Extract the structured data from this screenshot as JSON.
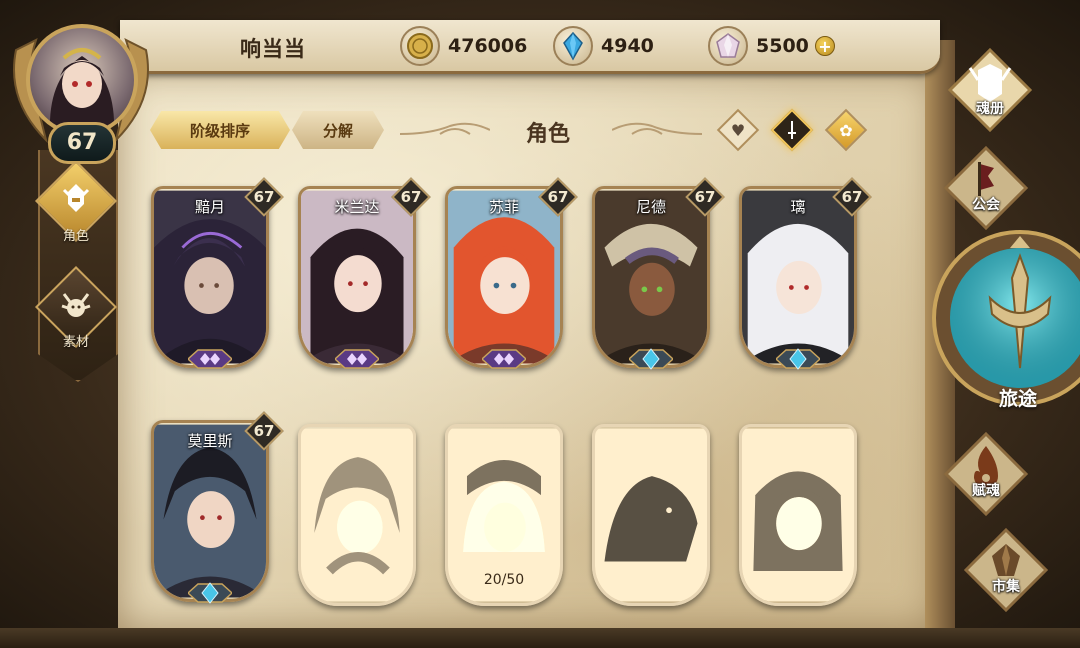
{
  "player": {
    "name": "响当当",
    "level": "67"
  },
  "currencies": [
    {
      "name": "gold",
      "icon": "gold-coin-icon",
      "value": "476006"
    },
    {
      "name": "gem",
      "icon": "blue-crystal-icon",
      "value": "4940"
    },
    {
      "name": "diamond",
      "icon": "pink-diamond-icon",
      "value": "5500",
      "has_plus": true
    }
  ],
  "left_nav": [
    {
      "label": "角色",
      "icon": "character-helmet-icon",
      "active": true
    },
    {
      "label": "素材",
      "icon": "material-beast-icon",
      "active": false
    }
  ],
  "toolbar": {
    "sort_label": "阶级排序",
    "decompose_label": "分解",
    "title": "角色"
  },
  "filters": [
    {
      "icon": "heart-filter-icon",
      "active": false
    },
    {
      "icon": "sword-filter-icon",
      "active": true
    },
    {
      "icon": "paw-filter-icon",
      "active": false
    }
  ],
  "owned_cards": [
    {
      "name": "黯月",
      "level": "67"
    },
    {
      "name": "米兰达",
      "level": "67"
    },
    {
      "name": "苏菲",
      "level": "67"
    },
    {
      "name": "尼德",
      "level": "67"
    },
    {
      "name": "璃",
      "level": "67"
    },
    {
      "name": "莫里斯",
      "level": "67"
    }
  ],
  "locked_cards": [
    {
      "progress": ""
    },
    {
      "progress": "20/50"
    },
    {
      "progress": ""
    },
    {
      "progress": ""
    }
  ],
  "right_menu": [
    {
      "label": "魂册",
      "icon": "soul-book-icon"
    },
    {
      "label": "公会",
      "icon": "guild-banner-icon"
    },
    {
      "label": "旅途",
      "icon": "journey-emblem-icon"
    },
    {
      "label": "赋魂",
      "icon": "soul-flame-icon"
    },
    {
      "label": "市集",
      "icon": "market-gem-icon"
    }
  ],
  "colors": {
    "gold": "#d9b25a",
    "parchment": "#e2d3b0",
    "teal": "#3fb7c4",
    "purple": "#8a5cc8",
    "cyan_gem": "#49c6e8"
  }
}
